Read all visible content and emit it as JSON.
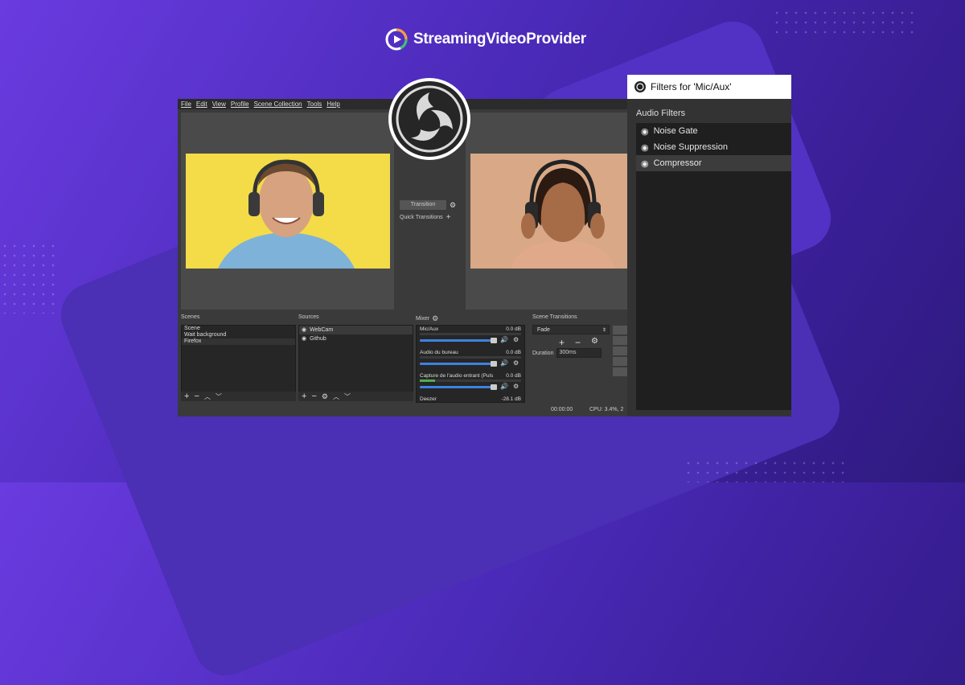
{
  "brand": {
    "name": "StreamingVideoProvider",
    "icon": "play-logo-icon"
  },
  "obs": {
    "menu": [
      "File",
      "Edit",
      "View",
      "Profile",
      "Scene Collection",
      "Tools",
      "Help"
    ],
    "transition": {
      "button_label": "Transition",
      "quick_label": "Quick Transitions"
    },
    "docks": {
      "scenes": {
        "title": "Scenes",
        "items": [
          "Scene",
          "Wait background",
          "Firefox"
        ]
      },
      "sources": {
        "title": "Sources",
        "items": [
          "WebCam",
          "Github"
        ]
      },
      "mixer": {
        "title": "Mixer",
        "channels": [
          {
            "name": "Mic/Aux",
            "db": "0.0 dB",
            "level": 0.02
          },
          {
            "name": "Audio du bureau",
            "db": "0.0 dB",
            "level": 0.0
          },
          {
            "name": "Capture de l'audio entrant (Puls",
            "db": "0.0 dB",
            "level": 0.15
          },
          {
            "name": "Deezer",
            "db": "-28.1 dB",
            "level": 0.0
          }
        ]
      },
      "scene_transitions": {
        "title": "Scene Transitions",
        "selected": "Fade",
        "duration_label": "Duration",
        "duration_value": "300ms"
      }
    },
    "status": {
      "time": "00:00:00",
      "cpu": "CPU: 3.4%, 2"
    }
  },
  "filters": {
    "title": "Filters for 'Mic/Aux'",
    "section": "Audio Filters",
    "items": [
      "Noise Gate",
      "Noise Suppression",
      "Compressor"
    ],
    "selected_index": 2
  },
  "colors": {
    "accent_blue": "#3c82e0",
    "bg_purple": "#5a33d0"
  }
}
